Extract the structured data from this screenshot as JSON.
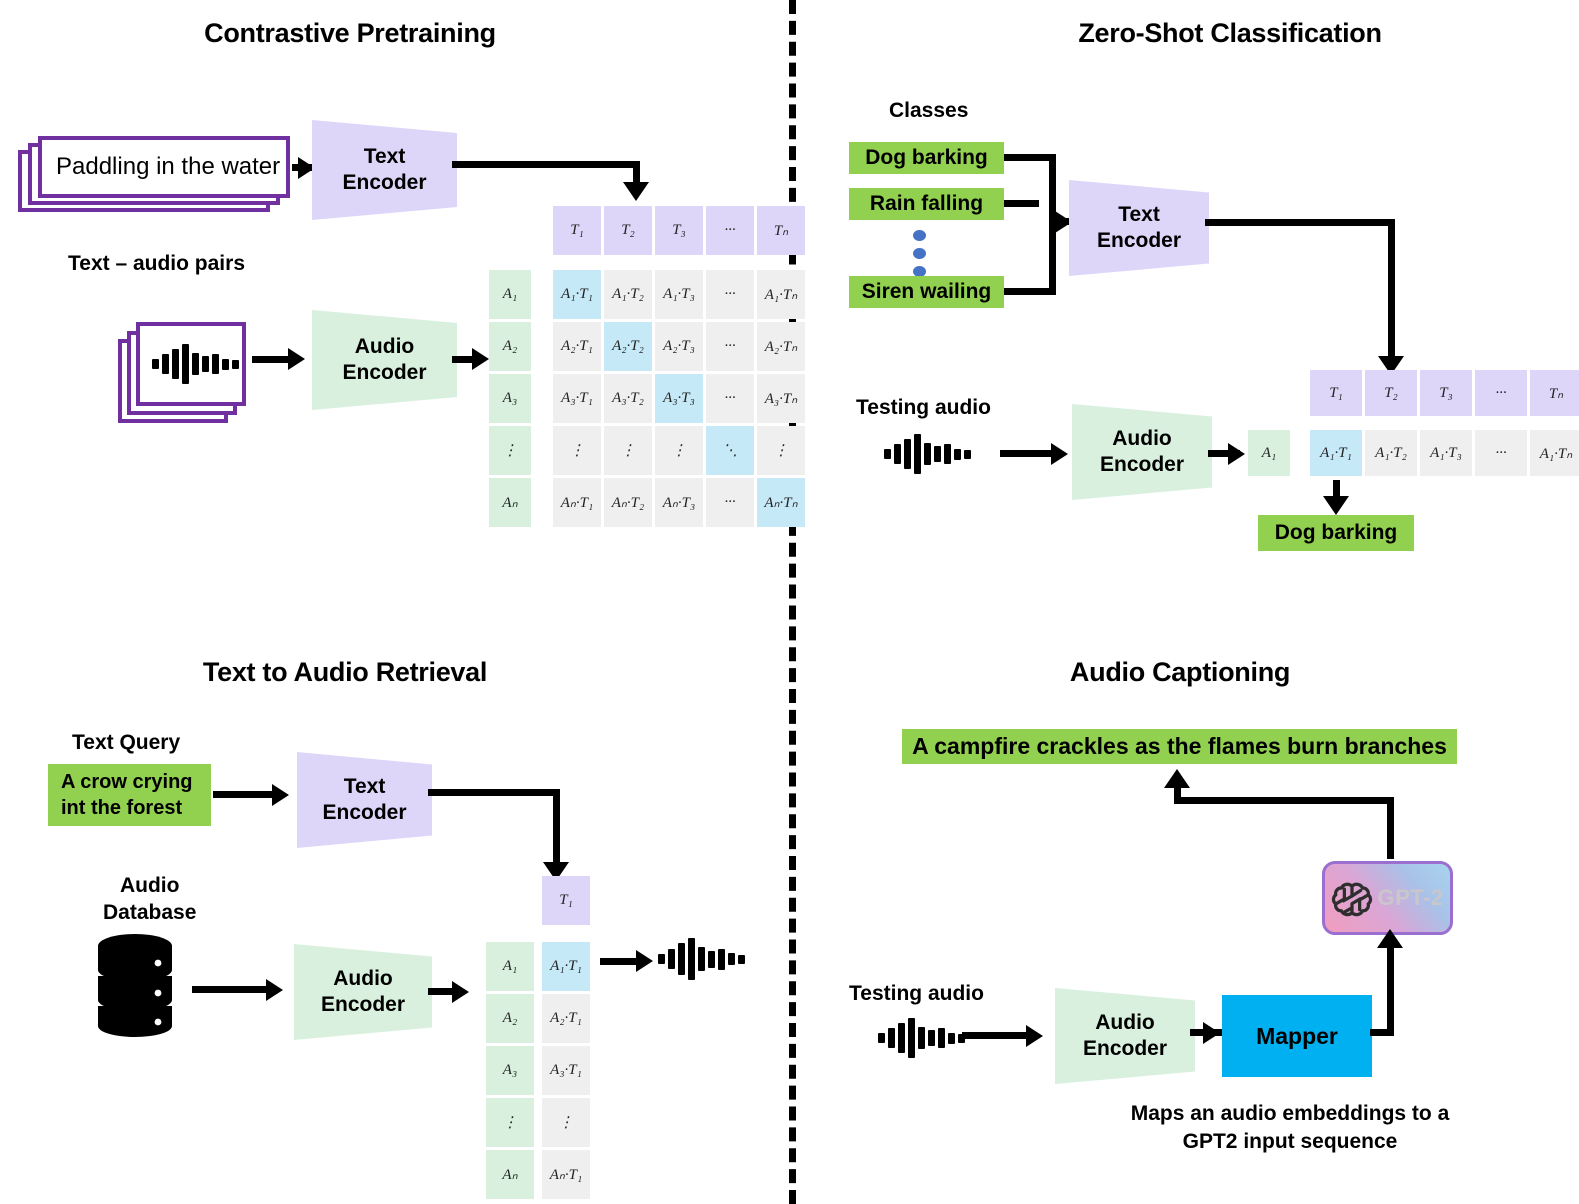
{
  "panels": {
    "contrastive": {
      "title": "Contrastive Pretraining",
      "sample_text": "Paddling in the water",
      "pairs_label": "Text – audio pairs",
      "text_encoder": {
        "line1": "Text",
        "line2": "Encoder"
      },
      "audio_encoder": {
        "line1": "Audio",
        "line2": "Encoder"
      },
      "matrix": {
        "col_headers": [
          "T₁",
          "T₂",
          "T₃",
          "···",
          "Tₙ"
        ],
        "row_headers": [
          "A₁",
          "A₂",
          "A₃",
          "⋮",
          "Aₙ"
        ],
        "rows": [
          [
            "A₁·T₁",
            "A₁·T₂",
            "A₁·T₃",
            "···",
            "A₁·Tₙ"
          ],
          [
            "A₂·T₁",
            "A₂·T₂",
            "A₂·T₃",
            "···",
            "A₂·Tₙ"
          ],
          [
            "A₃·T₁",
            "A₃·T₂",
            "A₃·T₃",
            "···",
            "A₃·Tₙ"
          ],
          [
            "⋮",
            "⋮",
            "⋮",
            "⋱",
            "⋮"
          ],
          [
            "Aₙ·T₁",
            "Aₙ·T₂",
            "Aₙ·T₃",
            "···",
            "Aₙ·Tₙ"
          ]
        ],
        "diagonal_highlighted": true
      }
    },
    "zeroshot": {
      "title": "Zero-Shot Classification",
      "classes_label": "Classes",
      "classes": [
        "Dog barking",
        "Rain falling",
        "Siren wailing"
      ],
      "ellipsis_icon": "vertical-dots",
      "text_encoder": {
        "line1": "Text",
        "line2": "Encoder"
      },
      "audio_encoder": {
        "line1": "Audio",
        "line2": "Encoder"
      },
      "testing_audio_label": "Testing audio",
      "vector": {
        "col_headers": [
          "T₁",
          "T₂",
          "T₃",
          "···",
          "Tₙ"
        ],
        "row_header": "A₁",
        "cells": [
          "A₁·T₁",
          "A₁·T₂",
          "A₁·T₃",
          "···",
          "A₁·Tₙ"
        ],
        "highlight_index": 0
      },
      "prediction": "Dog barking"
    },
    "retrieval": {
      "title": "Text to Audio Retrieval",
      "text_query_label": "Text Query",
      "query_line1": "A crow crying",
      "query_line2": "int the forest",
      "audio_db_line1": "Audio",
      "audio_db_line2": "Database",
      "db_icon": "database-cylinder-icon",
      "text_encoder": {
        "line1": "Text",
        "line2": "Encoder"
      },
      "audio_encoder": {
        "line1": "Audio",
        "line2": "Encoder"
      },
      "column": {
        "header": "T₁",
        "row_headers": [
          "A₁",
          "A₂",
          "A₃",
          "⋮",
          "Aₙ"
        ],
        "cells": [
          "A₁·T₁",
          "A₂·T₁",
          "A₃·T₁",
          "⋮",
          "Aₙ·T₁"
        ],
        "highlight_index": 0
      },
      "result_icon": "audio-waveform-icon"
    },
    "captioning": {
      "title": "Audio Captioning",
      "caption_output": "A campfire crackles as the flames burn branches",
      "gpt_logo_text": "GPT-2",
      "gpt_logo_icon": "openai-logo-icon",
      "testing_audio_label": "Testing audio",
      "audio_encoder": {
        "line1": "Audio",
        "line2": "Encoder"
      },
      "mapper_label": "Mapper",
      "note_line1": "Maps an audio embeddings to a",
      "note_line2": "GPT2 input sequence"
    }
  },
  "colors": {
    "green_chip": "#92d050",
    "purple_block": "#ddd6f9",
    "green_block": "#d8f0dd",
    "highlight_cyan": "#c6e9f7",
    "neutral_cell": "#efefef",
    "mapper_blue": "#00b0f0",
    "card_border_purple": "#7030a0",
    "dots_blue": "#4472c4"
  }
}
